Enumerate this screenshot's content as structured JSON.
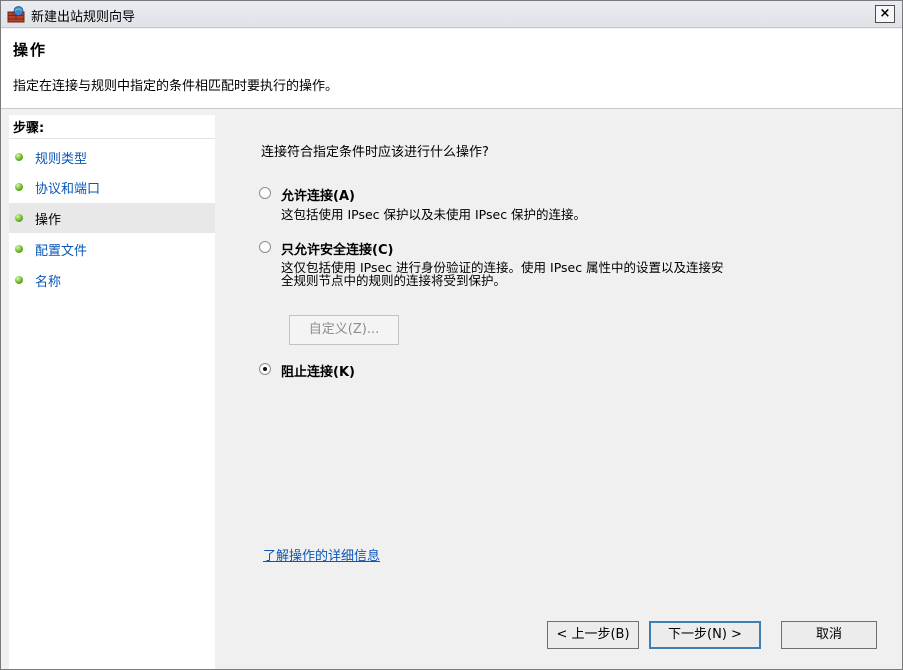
{
  "window": {
    "title": "新建出站规则向导",
    "close_label": "×"
  },
  "header": {
    "title": "操作",
    "description": "指定在连接与规则中指定的条件相匹配时要执行的操作。"
  },
  "sidebar": {
    "steps_label": "步骤:",
    "items": [
      {
        "label": "规则类型",
        "active": false
      },
      {
        "label": "协议和端口",
        "active": false
      },
      {
        "label": "操作",
        "active": true
      },
      {
        "label": "配置文件",
        "active": false
      },
      {
        "label": "名称",
        "active": false
      }
    ]
  },
  "main": {
    "question": "连接符合指定条件时应该进行什么操作?",
    "options": [
      {
        "label": "允许连接(A)",
        "description": "这包括使用 IPsec 保护以及未使用 IPsec 保护的连接。",
        "checked": false
      },
      {
        "label": "只允许安全连接(C)",
        "description_line1": "这仅包括使用 IPsec 进行身份验证的连接。使用 IPsec 属性中的设置以及连接安",
        "description_line2": "全规则节点中的规则的连接将受到保护。",
        "checked": false
      },
      {
        "label": "阻止连接(K)",
        "checked": true
      }
    ],
    "customize_label": "自定义(Z)...",
    "learn_more_label": "了解操作的详细信息"
  },
  "buttons": {
    "back_label": "< 上一步(B)",
    "next_label": "下一步(N) >",
    "cancel_label": "取消"
  },
  "colors": {
    "link": "#0a57b8",
    "panel": "#f0f0f0",
    "header_bg": "#ffffff"
  }
}
